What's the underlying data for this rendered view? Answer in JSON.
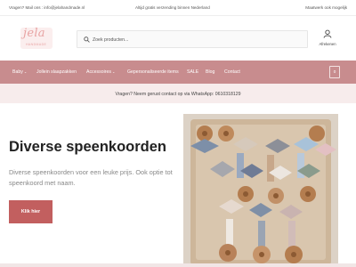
{
  "topbar": {
    "left": "Vragen? Mail ons : info@jelahandmade.nl",
    "center": "Altijd gratis verzending binnen Nederland",
    "right": "Maatwerk ook mogelijk"
  },
  "header": {
    "logo_text": "jela",
    "logo_sub": "HANDMADE",
    "search_placeholder": "Zoek producten...",
    "account_label": "Afrekenen"
  },
  "nav": {
    "items": [
      "Baby",
      "Jollein slaapzakken",
      "Accessoires",
      "Gepersonaliseerde items",
      "SALE",
      "Blog",
      "Contact"
    ],
    "chevron": "⌄",
    "cart_count": "0"
  },
  "notice": {
    "text": "Vragen? Neem gerust contact op via WhatsApp: 0610318129"
  },
  "hero": {
    "title": "Diverse speenkoorden",
    "text": "Diverse speenkoorden voor een leuke prijs. Ook optie tot speenkoord met naam.",
    "button_label": "Klik hier"
  },
  "colors": {
    "brand_pink": "#c88c8e",
    "button_red": "#c25f5f",
    "notice_bg": "#f7ecec"
  }
}
